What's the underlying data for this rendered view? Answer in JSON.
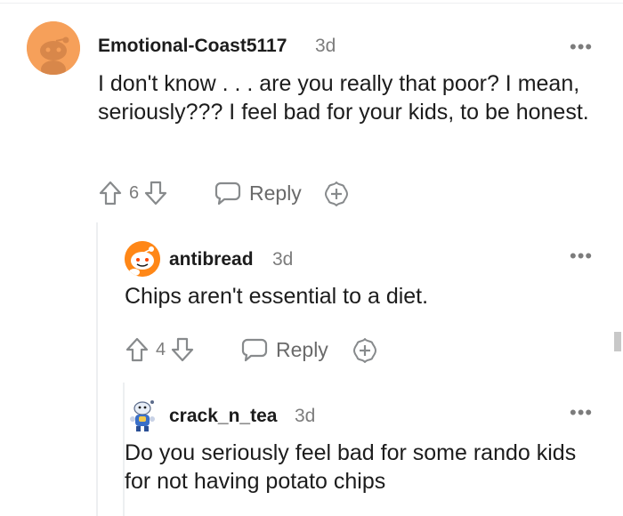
{
  "comments": [
    {
      "username": "Emotional-Coast5117",
      "time": "3d",
      "body": "I don't know . . . are you really that poor? I mean, seriously??? I feel bad for your kids, to be honest.",
      "votes": "6",
      "reply_label": "Reply",
      "more": "•••"
    },
    {
      "username": "antibread",
      "time": "3d",
      "body": "Chips aren't essential to a diet.",
      "votes": "4",
      "reply_label": "Reply",
      "more": "•••"
    },
    {
      "username": "crack_n_tea",
      "time": "3d",
      "body": "Do you seriously feel bad for some rando kids for not having potato chips",
      "more": "•••"
    }
  ],
  "colors": {
    "avatar1_bg": "#f6a05a",
    "avatar2_bg": "#ff8717",
    "text": "#1c1c1c",
    "meta": "#7c7c7c"
  }
}
